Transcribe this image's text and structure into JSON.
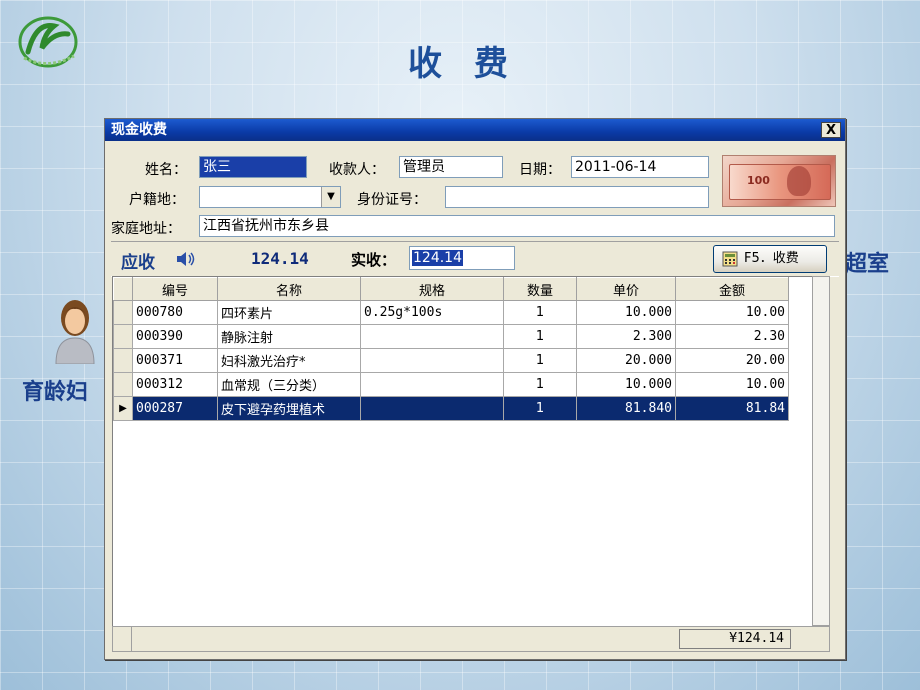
{
  "slide": {
    "title": "收 费",
    "left_text": "育龄妇",
    "right_text": "超室"
  },
  "dialog": {
    "title": "现金收费",
    "close_label": "X",
    "name_label": "姓名：",
    "name_value": "张三",
    "cashier_label": "收款人：",
    "cashier_value": "管理员",
    "date_label": "日期：",
    "date_value": "2011-06-14",
    "huji_label": "户籍地：",
    "huji_value": "",
    "idcard_label": "身份证号：",
    "idcard_value": "",
    "address_label": "家庭地址：",
    "address_value": "江西省抚州市东乡县",
    "banknote_value": "100",
    "receivable_label": "应收",
    "receivable_value": "124.14",
    "received_label": "实收：",
    "received_value": "124.14",
    "pay_button_label": "F5．收费",
    "columns": [
      "编号",
      "名称",
      "规格",
      "数量",
      "单价",
      "金额"
    ],
    "rows": [
      {
        "code": "000780",
        "name": "四环素片",
        "spec": "0.25g*100s",
        "qty": "1",
        "price": "10.000",
        "amount": "10.00"
      },
      {
        "code": "000390",
        "name": "静脉注射",
        "spec": "",
        "qty": "1",
        "price": "2.300",
        "amount": "2.30"
      },
      {
        "code": "000371",
        "name": "妇科激光治疗*",
        "spec": "",
        "qty": "1",
        "price": "20.000",
        "amount": "20.00"
      },
      {
        "code": "000312",
        "name": "血常规（三分类）",
        "spec": "",
        "qty": "1",
        "price": "10.000",
        "amount": "10.00"
      },
      {
        "code": "000287",
        "name": "皮下避孕药埋植术",
        "spec": "",
        "qty": "1",
        "price": "81.840",
        "amount": "81.84"
      }
    ],
    "selected_row_index": 4,
    "row_pointer": "▶",
    "total": "¥124.14"
  },
  "colors": {
    "title_blue": "#1d4f9a",
    "selection": "#0b2a6f",
    "titlebar": "#0a3aa6"
  },
  "icons": [
    "logo-icon",
    "person-icon",
    "speaker-icon",
    "calculator-icon",
    "banknote-image"
  ]
}
